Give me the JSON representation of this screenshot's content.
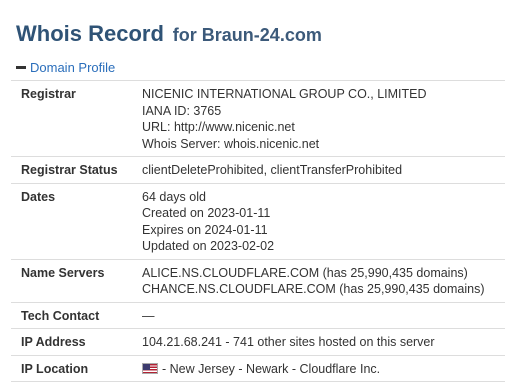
{
  "header": {
    "title": "Whois Record",
    "subtitle": "for Braun-24.com"
  },
  "section": {
    "toggle_icon": "minus-icon",
    "label": "Domain Profile"
  },
  "rows": {
    "registrar": {
      "label": "Registrar",
      "lines": [
        "NICENIC INTERNATIONAL GROUP CO., LIMITED",
        "IANA ID: 3765",
        "URL: http://www.nicenic.net",
        "Whois Server: whois.nicenic.net"
      ]
    },
    "registrar_status": {
      "label": "Registrar Status",
      "value": "clientDeleteProhibited, clientTransferProhibited"
    },
    "dates": {
      "label": "Dates",
      "lines": [
        "64 days old",
        "Created on 2023-01-11",
        "Expires on 2024-01-11",
        "Updated on 2023-02-02"
      ]
    },
    "name_servers": {
      "label": "Name Servers",
      "lines": [
        "ALICE.NS.CLOUDFLARE.COM (has 25,990,435 domains)",
        "CHANCE.NS.CLOUDFLARE.COM (has 25,990,435 domains)"
      ]
    },
    "tech_contact": {
      "label": "Tech Contact",
      "value": "—"
    },
    "ip_address": {
      "label": "IP Address",
      "value": "104.21.68.241 - 741 other sites hosted on this server"
    },
    "ip_location": {
      "label": "IP Location",
      "flag_icon": "us-flag-icon",
      "value": "- New Jersey - Newark - Cloudflare Inc."
    }
  }
}
